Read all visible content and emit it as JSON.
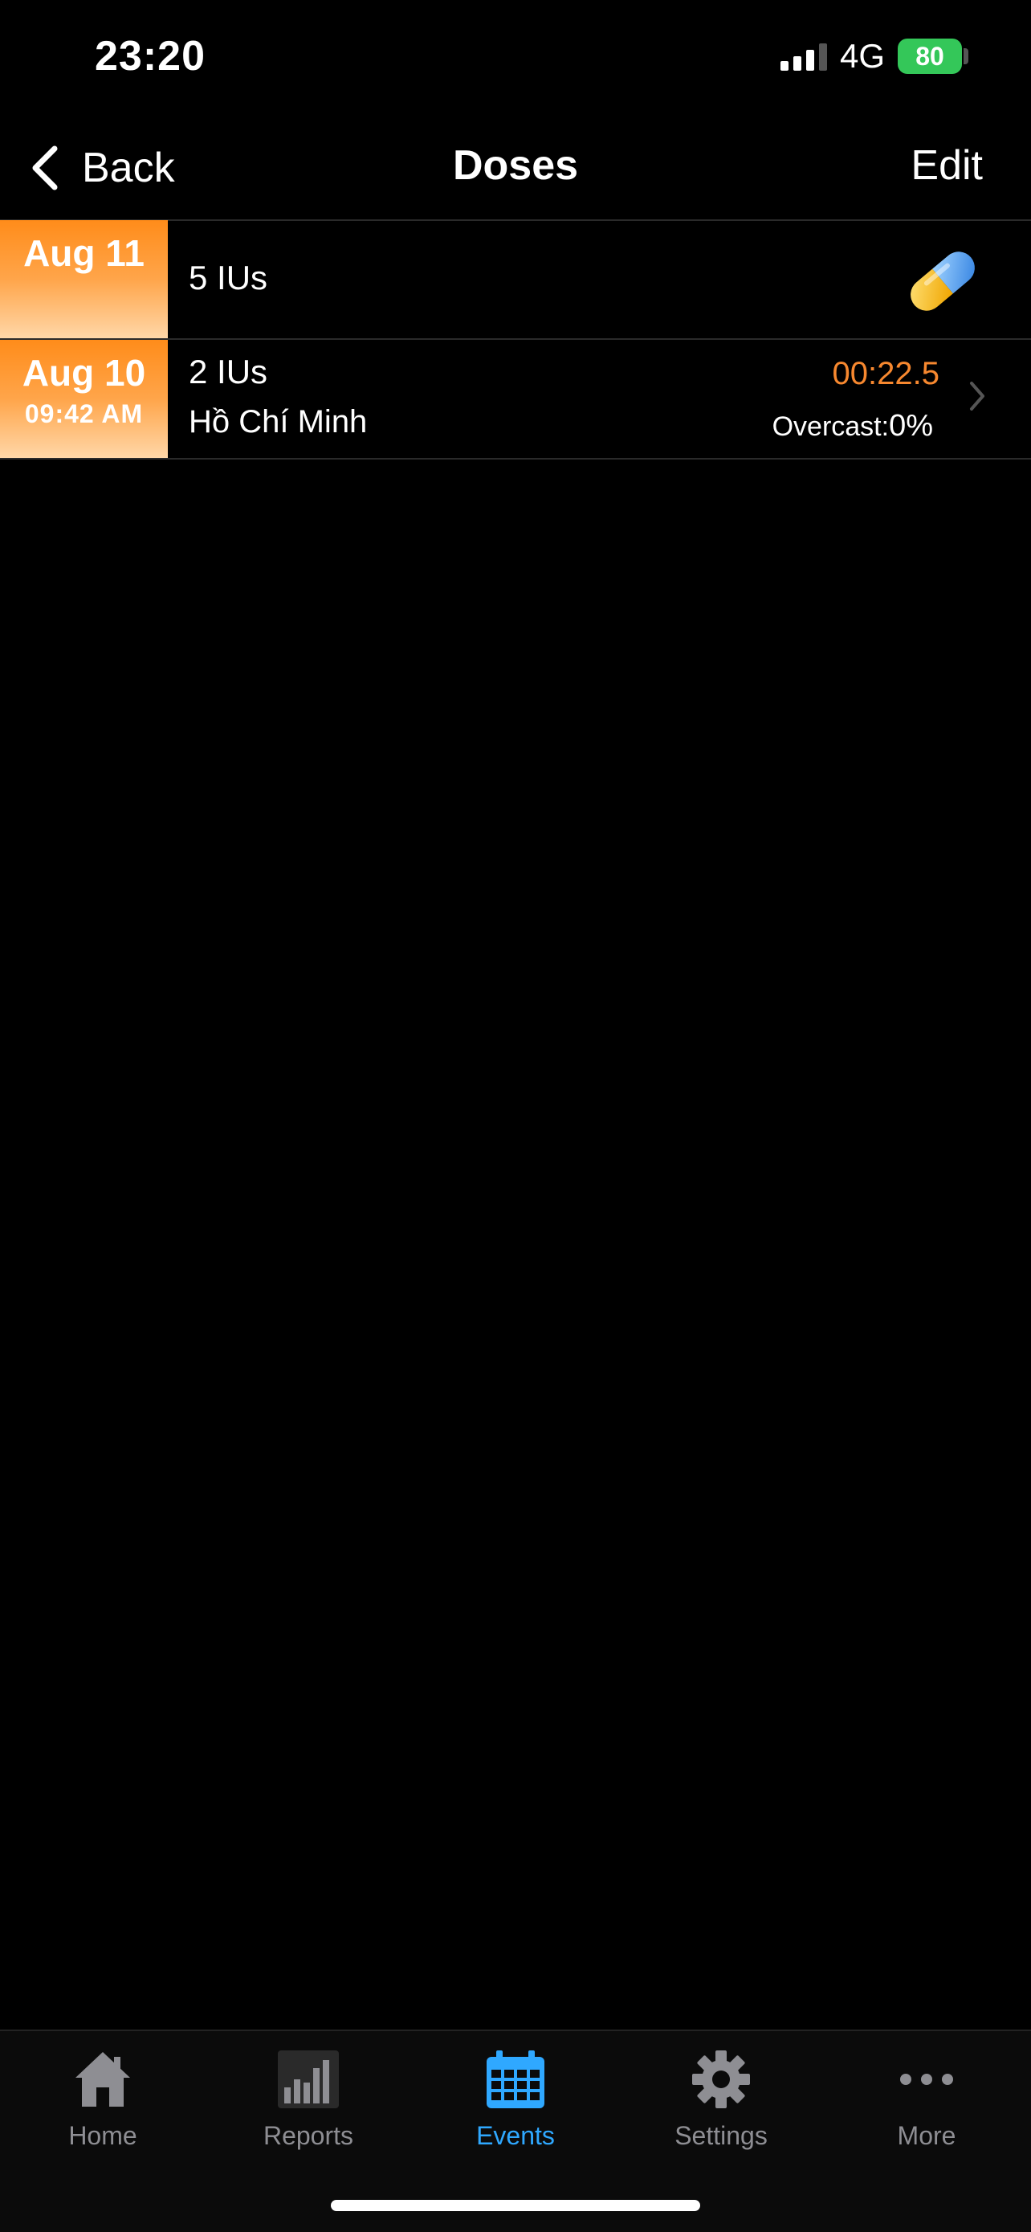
{
  "status_bar": {
    "time": "23:20",
    "network": "4G",
    "battery": "80"
  },
  "nav": {
    "back_label": "Back",
    "title": "Doses",
    "edit_label": "Edit"
  },
  "rows": [
    {
      "date": "Aug 11",
      "time": "",
      "dose": "5 IUs",
      "icon": "pill-icon"
    },
    {
      "date": "Aug 10",
      "time": "09:42 AM",
      "dose": "2 IUs",
      "location": "Hồ Chí Minh",
      "duration": "00:22.5",
      "weather_label": "Overcast:",
      "weather_value": "0%"
    }
  ],
  "tabs": [
    {
      "label": "Home",
      "icon": "home-icon"
    },
    {
      "label": "Reports",
      "icon": "bar-chart-icon"
    },
    {
      "label": "Events",
      "icon": "calendar-icon",
      "active": true
    },
    {
      "label": "Settings",
      "icon": "gear-icon"
    },
    {
      "label": "More",
      "icon": "ellipsis-icon"
    }
  ],
  "colors": {
    "accent_orange": "#f7882f",
    "active_tab": "#2fa8ff",
    "battery_green": "#34c759"
  }
}
